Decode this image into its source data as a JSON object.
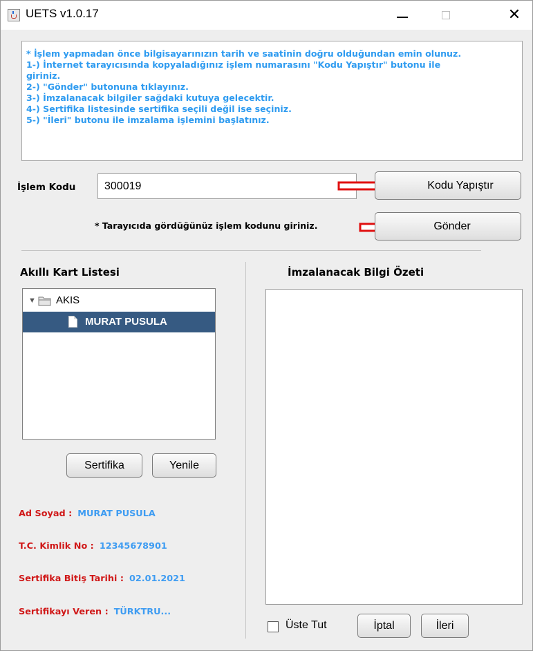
{
  "window": {
    "title": "UETS v1.0.17"
  },
  "info": {
    "lines": [
      "* İşlem yapmadan önce bilgisayarınızın tarih ve saatinin doğru olduğundan emin olunuz.",
      "1-) İnternet tarayıcısında kopyaladığınız işlem numarasını \"Kodu Yapıştır\" butonu ile",
      "giriniz.",
      "2-) \"Gönder\" butonuna tıklayınız.",
      "3-) İmzalanacak bilgiler sağdaki kutuya gelecektir.",
      "4-) Sertifika listesinde sertifika seçili değil ise seçiniz.",
      "5-) \"İleri\" butonu ile imzalama işlemini başlatınız."
    ],
    "color": "#2e9bf0"
  },
  "form": {
    "islem_label": "İşlem Kodu",
    "islem_value": "300019",
    "kodu_button": "Kodu Yapıştır",
    "gonder_button": "Gönder",
    "hint": "* Tarayıcıda gördüğünüz işlem kodunu giriniz."
  },
  "card_list": {
    "title": "Akıllı Kart Listesi",
    "root": "AKIS",
    "selected_item": "MURAT PUSULA",
    "sertifika_button": "Sertifika",
    "yenile_button": "Yenile"
  },
  "details": {
    "ad_soyad_label": "Ad Soyad :",
    "ad_soyad_value": "MURAT PUSULA",
    "tc_label": "T.C. Kimlik No :",
    "tc_value": "12345678901",
    "bitis_label": "Sertifika Bitiş Tarihi :",
    "bitis_value": "02.01.2021",
    "veren_label": "Sertifikayı Veren :",
    "veren_value": "TÜRKTRU..."
  },
  "summary": {
    "title": "İmzalanacak Bilgi Özeti",
    "content": ""
  },
  "footer": {
    "uste_tut_label": "Üste Tut",
    "uste_tut_checked": false,
    "iptal_button": "İptal",
    "ileri_button": "İleri"
  },
  "colors": {
    "annotation_arrow": "#e01010",
    "label_red": "#d01818",
    "value_blue": "#3e9cf2",
    "selection": "#365a82"
  }
}
